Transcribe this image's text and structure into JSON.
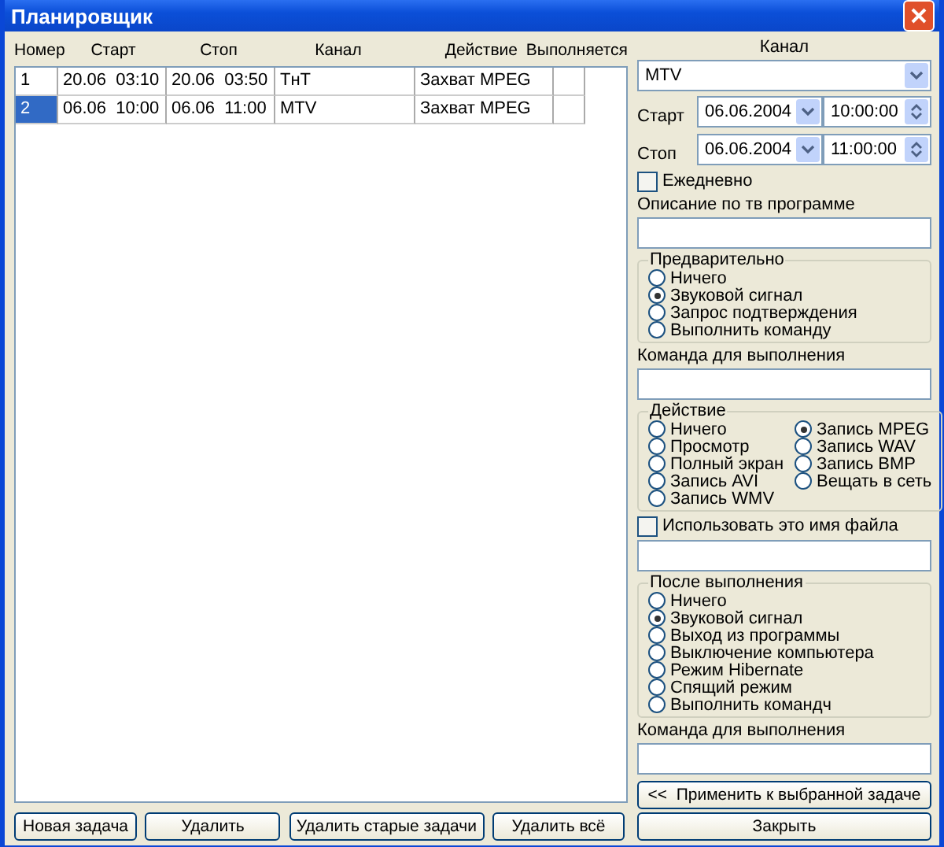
{
  "window": {
    "title": "Планировщик"
  },
  "table": {
    "columns": [
      "Номер",
      "Старт",
      "Стоп",
      "Канал",
      "Действие",
      "Выполняется"
    ],
    "rows": [
      {
        "cells": [
          "1",
          "20.06  03:10",
          "20.06  03:50",
          "ТнТ",
          "Захват MPEG",
          ""
        ],
        "selected": false
      },
      {
        "cells": [
          "2",
          "06.06  10:00",
          "06.06  11:00",
          "MTV",
          "Захват MPEG",
          ""
        ],
        "selected": true
      }
    ]
  },
  "buttons": [
    "Новая задача",
    "Удалить",
    "Удалить старые задачи",
    "Удалить всё"
  ],
  "form": {
    "channel_label": "Канал",
    "channel": "MTV",
    "start": {
      "label": "Старт",
      "date": "06.06.2004",
      "time": "10:00:00"
    },
    "stop": {
      "label": "Стоп",
      "date": "06.06.2004",
      "time": "11:00:00"
    },
    "daily": {
      "label": "Ежедневно",
      "checked": false
    },
    "description_label": "Описание по тв программе",
    "pre": {
      "title": "Предварительно",
      "options": [
        {
          "label": "Ничего",
          "selected": false
        },
        {
          "label": "Звуковой сигнал",
          "selected": true
        },
        {
          "label": "Запрос подтверждения",
          "selected": false
        },
        {
          "label": "Выполнить команду",
          "selected": false
        }
      ]
    },
    "command_label": "Команда для выполнения",
    "action": {
      "title": "Действие",
      "options": [
        {
          "label": "Ничего",
          "selected": false
        },
        {
          "label": "Просмотр",
          "selected": false
        },
        {
          "label": "Полный экран",
          "selected": false
        },
        {
          "label": "Запись AVI",
          "selected": false
        },
        {
          "label": "Запись WMV",
          "selected": false
        },
        {
          "label": "Запись MPEG",
          "selected": true
        },
        {
          "label": "Запись WAV",
          "selected": false
        },
        {
          "label": "Запись BMP",
          "selected": false
        },
        {
          "label": "Вещать в сеть",
          "selected": false
        }
      ]
    },
    "use_filename": {
      "label": "Использовать это имя файла",
      "checked": false
    },
    "after": {
      "title": "После выполнения",
      "options": [
        {
          "label": "Ничего",
          "selected": false
        },
        {
          "label": "Звуковой сигнал",
          "selected": true
        },
        {
          "label": "Выход из программы",
          "selected": false
        },
        {
          "label": "Выключение компьютера",
          "selected": false
        },
        {
          "label": "Режим Hibernate",
          "selected": false
        },
        {
          "label": "Спящий режим",
          "selected": false
        },
        {
          "label": "Выполнить командч",
          "selected": false
        }
      ]
    },
    "after_command_label": "Команда для выполнения",
    "apply_button": "<<  Применить к выбранной задаче",
    "close_button": "Закрыть"
  }
}
